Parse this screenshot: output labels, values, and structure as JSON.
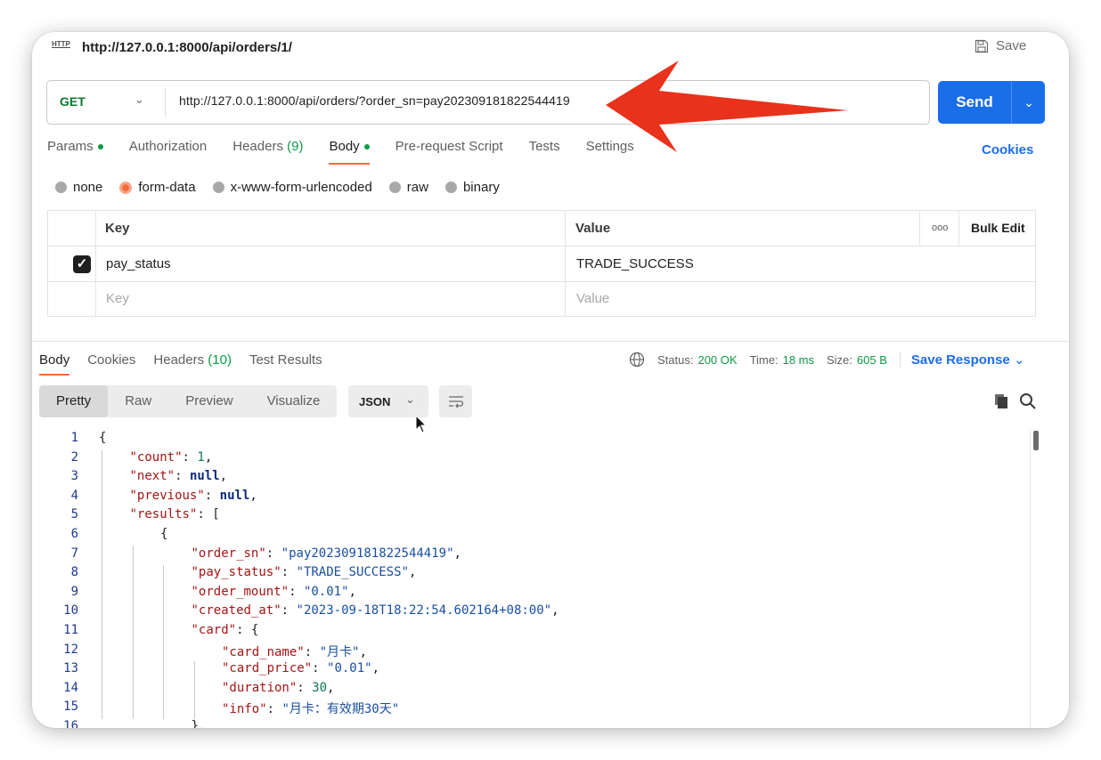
{
  "request": {
    "title": "http://127.0.0.1:8000/api/orders/1/",
    "icon_text": "HTTP",
    "save_label": "Save",
    "method": "GET",
    "url": "http://127.0.0.1:8000/api/orders/?order_sn=pay202309181822544419",
    "send_label": "Send"
  },
  "request_tabs": [
    {
      "label": "Params",
      "dot": true
    },
    {
      "label": "Authorization"
    },
    {
      "label": "Headers",
      "count": "(9)"
    },
    {
      "label": "Body",
      "dot": true,
      "active": true
    },
    {
      "label": "Pre-request Script"
    },
    {
      "label": "Tests"
    },
    {
      "label": "Settings"
    }
  ],
  "cookies_label": "Cookies",
  "body_types": [
    "none",
    "form-data",
    "x-www-form-urlencoded",
    "raw",
    "binary"
  ],
  "body_type_selected": "form-data",
  "form_table": {
    "headers": {
      "key": "Key",
      "value": "Value",
      "more": "ooo",
      "bulk": "Bulk Edit"
    },
    "rows": [
      {
        "key": "pay_status",
        "value": "TRADE_SUCCESS",
        "checked": true
      }
    ],
    "placeholder": {
      "key": "Key",
      "value": "Value"
    }
  },
  "response_tabs": [
    {
      "label": "Body",
      "active": true
    },
    {
      "label": "Cookies"
    },
    {
      "label": "Headers",
      "count": "(10)"
    },
    {
      "label": "Test Results"
    }
  ],
  "status": {
    "status_label": "Status:",
    "status_value": "200 OK",
    "time_label": "Time:",
    "time_value": "18 ms",
    "size_label": "Size:",
    "size_value": "605 B",
    "save_response": "Save Response"
  },
  "view_tabs": [
    "Pretty",
    "Raw",
    "Preview",
    "Visualize"
  ],
  "view_selected": "Pretty",
  "format": "JSON",
  "code_lines": [
    {
      "n": "1",
      "indent": 0,
      "parts": [
        [
          "p",
          "{"
        ]
      ]
    },
    {
      "n": "2",
      "indent": 1,
      "parts": [
        [
          "k",
          "\"count\""
        ],
        [
          "p",
          ": "
        ],
        [
          "n",
          "1"
        ],
        [
          "p",
          ","
        ]
      ]
    },
    {
      "n": "3",
      "indent": 1,
      "parts": [
        [
          "k",
          "\"next\""
        ],
        [
          "p",
          ": "
        ],
        [
          "nu",
          "null"
        ],
        [
          "p",
          ","
        ]
      ]
    },
    {
      "n": "4",
      "indent": 1,
      "parts": [
        [
          "k",
          "\"previous\""
        ],
        [
          "p",
          ": "
        ],
        [
          "nu",
          "null"
        ],
        [
          "p",
          ","
        ]
      ]
    },
    {
      "n": "5",
      "indent": 1,
      "parts": [
        [
          "k",
          "\"results\""
        ],
        [
          "p",
          ": ["
        ]
      ]
    },
    {
      "n": "6",
      "indent": 2,
      "parts": [
        [
          "p",
          "{"
        ]
      ]
    },
    {
      "n": "7",
      "indent": 3,
      "parts": [
        [
          "k",
          "\"order_sn\""
        ],
        [
          "p",
          ": "
        ],
        [
          "s",
          "\"pay202309181822544419\""
        ],
        [
          "p",
          ","
        ]
      ]
    },
    {
      "n": "8",
      "indent": 3,
      "parts": [
        [
          "k",
          "\"pay_status\""
        ],
        [
          "p",
          ": "
        ],
        [
          "s",
          "\"TRADE_SUCCESS\""
        ],
        [
          "p",
          ","
        ]
      ]
    },
    {
      "n": "9",
      "indent": 3,
      "parts": [
        [
          "k",
          "\"order_mount\""
        ],
        [
          "p",
          ": "
        ],
        [
          "s",
          "\"0.01\""
        ],
        [
          "p",
          ","
        ]
      ]
    },
    {
      "n": "10",
      "indent": 3,
      "parts": [
        [
          "k",
          "\"created_at\""
        ],
        [
          "p",
          ": "
        ],
        [
          "s",
          "\"2023-09-18T18:22:54.602164+08:00\""
        ],
        [
          "p",
          ","
        ]
      ]
    },
    {
      "n": "11",
      "indent": 3,
      "parts": [
        [
          "k",
          "\"card\""
        ],
        [
          "p",
          ": {"
        ]
      ]
    },
    {
      "n": "12",
      "indent": 4,
      "parts": [
        [
          "k",
          "\"card_name\""
        ],
        [
          "p",
          ": "
        ],
        [
          "s",
          "\"月卡\""
        ],
        [
          "p",
          ","
        ]
      ]
    },
    {
      "n": "13",
      "indent": 4,
      "parts": [
        [
          "k",
          "\"card_price\""
        ],
        [
          "p",
          ": "
        ],
        [
          "s",
          "\"0.01\""
        ],
        [
          "p",
          ","
        ]
      ]
    },
    {
      "n": "14",
      "indent": 4,
      "parts": [
        [
          "k",
          "\"duration\""
        ],
        [
          "p",
          ": "
        ],
        [
          "n",
          "30"
        ],
        [
          "p",
          ","
        ]
      ]
    },
    {
      "n": "15",
      "indent": 4,
      "parts": [
        [
          "k",
          "\"info\""
        ],
        [
          "p",
          ": "
        ],
        [
          "s",
          "\"月卡：有效期30天\""
        ]
      ]
    },
    {
      "n": "16",
      "indent": 3,
      "parts": [
        [
          "p",
          "},"
        ]
      ]
    }
  ],
  "colors": {
    "accent": "#f26b3a",
    "send": "#1b6ee9",
    "success": "#0a9a45",
    "arrow": "#e8321c"
  }
}
